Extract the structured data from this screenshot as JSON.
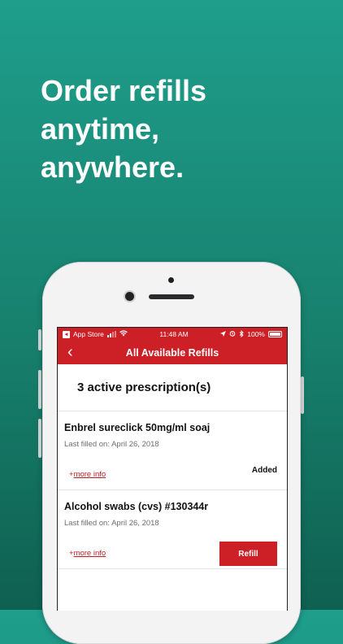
{
  "headline": {
    "line1": "Order refills",
    "line2": "anytime,",
    "line3": "anywhere."
  },
  "status_bar": {
    "carrier": "App Store",
    "time": "11:48 AM",
    "battery": "100%"
  },
  "nav": {
    "back_glyph": "‹",
    "title": "All Available Refills"
  },
  "summary": {
    "text": "3 active prescription(s)"
  },
  "prescriptions": [
    {
      "name": "Enbrel sureclick 50mg/ml soaj",
      "last_filled": "Last filled on: April 26, 2018",
      "more_prefix": "+",
      "more_link": "more info",
      "status": "Added"
    },
    {
      "name": "Alcohol swabs (cvs) #130344r",
      "last_filled": "Last filled on: April 26, 2018",
      "more_prefix": "+",
      "more_link": "more info",
      "action_label": "Refill"
    }
  ],
  "colors": {
    "background_top": "#1f9e8c",
    "brand_red": "#cc1f26",
    "headline": "#ffffff"
  },
  "icons": [
    "back-chevron-icon",
    "location-arrow-icon",
    "alarm-icon",
    "bluetooth-icon",
    "wifi-icon",
    "signal-icon",
    "battery-icon"
  ]
}
